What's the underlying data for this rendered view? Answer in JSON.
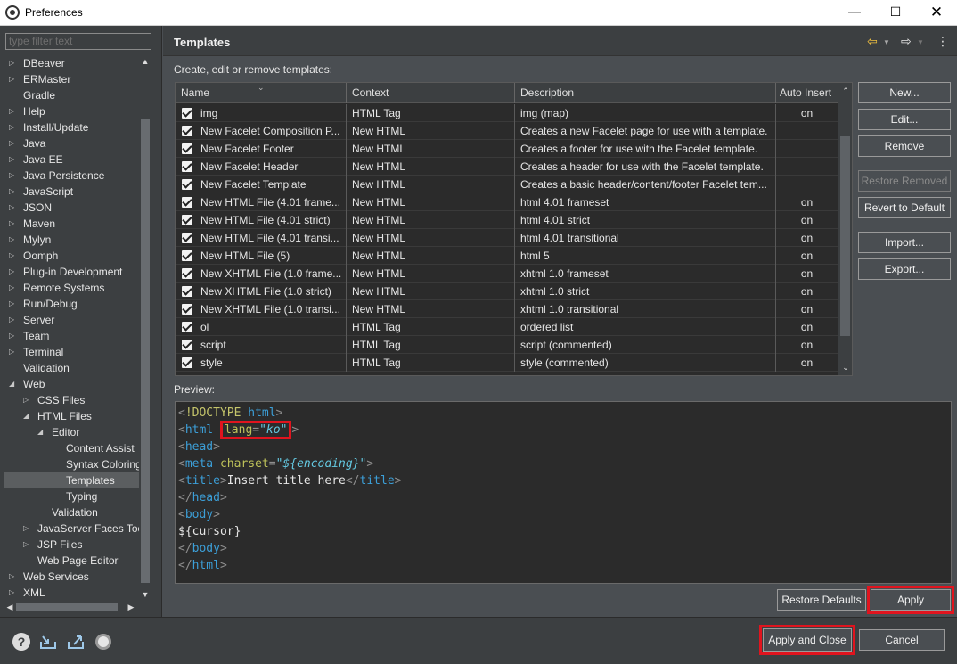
{
  "window": {
    "title": "Preferences",
    "min": "—",
    "max": "☐",
    "close": "✕"
  },
  "filter": {
    "placeholder": "type filter text"
  },
  "tree": [
    {
      "label": "DBeaver",
      "level": 0,
      "arrow": "▷"
    },
    {
      "label": "ERMaster",
      "level": 0,
      "arrow": "▷"
    },
    {
      "label": "Gradle",
      "level": 0,
      "arrow": ""
    },
    {
      "label": "Help",
      "level": 0,
      "arrow": "▷"
    },
    {
      "label": "Install/Update",
      "level": 0,
      "arrow": "▷"
    },
    {
      "label": "Java",
      "level": 0,
      "arrow": "▷"
    },
    {
      "label": "Java EE",
      "level": 0,
      "arrow": "▷"
    },
    {
      "label": "Java Persistence",
      "level": 0,
      "arrow": "▷"
    },
    {
      "label": "JavaScript",
      "level": 0,
      "arrow": "▷"
    },
    {
      "label": "JSON",
      "level": 0,
      "arrow": "▷"
    },
    {
      "label": "Maven",
      "level": 0,
      "arrow": "▷"
    },
    {
      "label": "Mylyn",
      "level": 0,
      "arrow": "▷"
    },
    {
      "label": "Oomph",
      "level": 0,
      "arrow": "▷"
    },
    {
      "label": "Plug-in Development",
      "level": 0,
      "arrow": "▷"
    },
    {
      "label": "Remote Systems",
      "level": 0,
      "arrow": "▷"
    },
    {
      "label": "Run/Debug",
      "level": 0,
      "arrow": "▷"
    },
    {
      "label": "Server",
      "level": 0,
      "arrow": "▷"
    },
    {
      "label": "Team",
      "level": 0,
      "arrow": "▷"
    },
    {
      "label": "Terminal",
      "level": 0,
      "arrow": "▷"
    },
    {
      "label": "Validation",
      "level": 0,
      "arrow": ""
    },
    {
      "label": "Web",
      "level": 0,
      "arrow": "◢"
    },
    {
      "label": "CSS Files",
      "level": 1,
      "arrow": "▷"
    },
    {
      "label": "HTML Files",
      "level": 1,
      "arrow": "◢"
    },
    {
      "label": "Editor",
      "level": 2,
      "arrow": "◢"
    },
    {
      "label": "Content Assist",
      "level": 3,
      "arrow": ""
    },
    {
      "label": "Syntax Coloring",
      "level": 3,
      "arrow": ""
    },
    {
      "label": "Templates",
      "level": 3,
      "arrow": "",
      "selected": true
    },
    {
      "label": "Typing",
      "level": 3,
      "arrow": ""
    },
    {
      "label": "Validation",
      "level": 2,
      "arrow": ""
    },
    {
      "label": "JavaServer Faces Tools",
      "level": 1,
      "arrow": "▷"
    },
    {
      "label": "JSP Files",
      "level": 1,
      "arrow": "▷"
    },
    {
      "label": "Web Page Editor",
      "level": 1,
      "arrow": ""
    },
    {
      "label": "Web Services",
      "level": 0,
      "arrow": "▷"
    },
    {
      "label": "XML",
      "level": 0,
      "arrow": "▷"
    }
  ],
  "page": {
    "title": "Templates",
    "subtitle": "Create, edit or remove templates:",
    "back_icon": "⇦",
    "forward_icon": "⇨",
    "menu_icon": "⋮"
  },
  "table": {
    "columns": [
      "Name",
      "Context",
      "Description",
      "Auto Insert"
    ],
    "rows": [
      {
        "name": "img",
        "context": "HTML Tag",
        "description": "img      (map)",
        "auto": "on"
      },
      {
        "name": "New Facelet Composition P...",
        "context": "New HTML",
        "description": "Creates a new Facelet page for use with a template.",
        "auto": ""
      },
      {
        "name": "New Facelet Footer",
        "context": "New HTML",
        "description": "Creates a footer for use with the Facelet template.",
        "auto": ""
      },
      {
        "name": "New Facelet Header",
        "context": "New HTML",
        "description": "Creates a header for use with the Facelet template.",
        "auto": ""
      },
      {
        "name": "New Facelet Template",
        "context": "New HTML",
        "description": "Creates a basic header/content/footer Facelet tem...",
        "auto": ""
      },
      {
        "name": "New HTML File (4.01 frame...",
        "context": "New HTML",
        "description": "html 4.01 frameset",
        "auto": "on"
      },
      {
        "name": "New HTML File (4.01 strict)",
        "context": "New HTML",
        "description": "html 4.01 strict",
        "auto": "on"
      },
      {
        "name": "New HTML File (4.01 transi...",
        "context": "New HTML",
        "description": "html 4.01 transitional",
        "auto": "on"
      },
      {
        "name": "New HTML File (5)",
        "context": "New HTML",
        "description": "html 5",
        "auto": "on"
      },
      {
        "name": "New XHTML File (1.0 frame...",
        "context": "New HTML",
        "description": "xhtml 1.0 frameset",
        "auto": "on"
      },
      {
        "name": "New XHTML File (1.0 strict)",
        "context": "New HTML",
        "description": "xhtml 1.0 strict",
        "auto": "on"
      },
      {
        "name": "New XHTML File (1.0 transi...",
        "context": "New HTML",
        "description": "xhtml 1.0 transitional",
        "auto": "on"
      },
      {
        "name": "ol",
        "context": "HTML Tag",
        "description": "ordered list",
        "auto": "on"
      },
      {
        "name": "script",
        "context": "HTML Tag",
        "description": "script      (commented)",
        "auto": "on"
      },
      {
        "name": "style",
        "context": "HTML Tag",
        "description": "style      (commented)",
        "auto": "on"
      }
    ]
  },
  "side_buttons": {
    "new": "New...",
    "edit": "Edit...",
    "remove": "Remove",
    "restore_removed": "Restore Removed",
    "revert": "Revert to Default",
    "import": "Import...",
    "export": "Export..."
  },
  "preview": {
    "label": "Preview:",
    "lines": [
      {
        "tokens": [
          [
            "c-br",
            "<"
          ],
          [
            "c-doc",
            "!DOCTYPE"
          ],
          [
            "c-text",
            " "
          ],
          [
            "c-tag",
            "html"
          ],
          [
            "c-br",
            ">"
          ]
        ]
      },
      {
        "tokens": [
          [
            "c-br",
            "<"
          ],
          [
            "c-tag",
            "html"
          ],
          [
            "c-text",
            " "
          ],
          [
            "box",
            ""
          ],
          [
            "c-br",
            ">"
          ]
        ]
      },
      {
        "tokens": [
          [
            "c-br",
            "<"
          ],
          [
            "c-tag",
            "head"
          ],
          [
            "c-br",
            ">"
          ]
        ]
      },
      {
        "tokens": [
          [
            "c-br",
            "<"
          ],
          [
            "c-tag",
            "meta"
          ],
          [
            "c-text",
            " "
          ],
          [
            "c-attr",
            "charset"
          ],
          [
            "c-br",
            "="
          ],
          [
            "c-val",
            "\"${encoding}\""
          ],
          [
            "c-br",
            ">"
          ]
        ]
      },
      {
        "tokens": [
          [
            "c-br",
            "<"
          ],
          [
            "c-tag",
            "title"
          ],
          [
            "c-br",
            ">"
          ],
          [
            "c-text",
            "Insert title here"
          ],
          [
            "c-br",
            "</"
          ],
          [
            "c-tag",
            "title"
          ],
          [
            "c-br",
            ">"
          ]
        ]
      },
      {
        "tokens": [
          [
            "c-br",
            "</"
          ],
          [
            "c-tag",
            "head"
          ],
          [
            "c-br",
            ">"
          ]
        ]
      },
      {
        "tokens": [
          [
            "c-br",
            "<"
          ],
          [
            "c-tag",
            "body"
          ],
          [
            "c-br",
            ">"
          ]
        ]
      },
      {
        "tokens": [
          [
            "c-text",
            "${cursor}"
          ]
        ]
      },
      {
        "tokens": [
          [
            "c-br",
            "</"
          ],
          [
            "c-tag",
            "body"
          ],
          [
            "c-br",
            ">"
          ]
        ]
      },
      {
        "tokens": [
          [
            "c-br",
            "</"
          ],
          [
            "c-tag",
            "html"
          ],
          [
            "c-br",
            ">"
          ]
        ]
      }
    ],
    "lang_attr": "lang",
    "lang_eq": "=",
    "lang_value": "\"ko\""
  },
  "actions": {
    "restore_defaults": "Restore Defaults",
    "apply": "Apply",
    "apply_close": "Apply and Close",
    "cancel": "Cancel"
  },
  "bottom_icons": [
    "help-icon",
    "import-icon",
    "export-icon",
    "record-icon"
  ],
  "colors": {
    "highlight": "#e0141e",
    "tag": "#3c9fd8",
    "attr": "#bec25a",
    "value": "#64c8e0"
  }
}
